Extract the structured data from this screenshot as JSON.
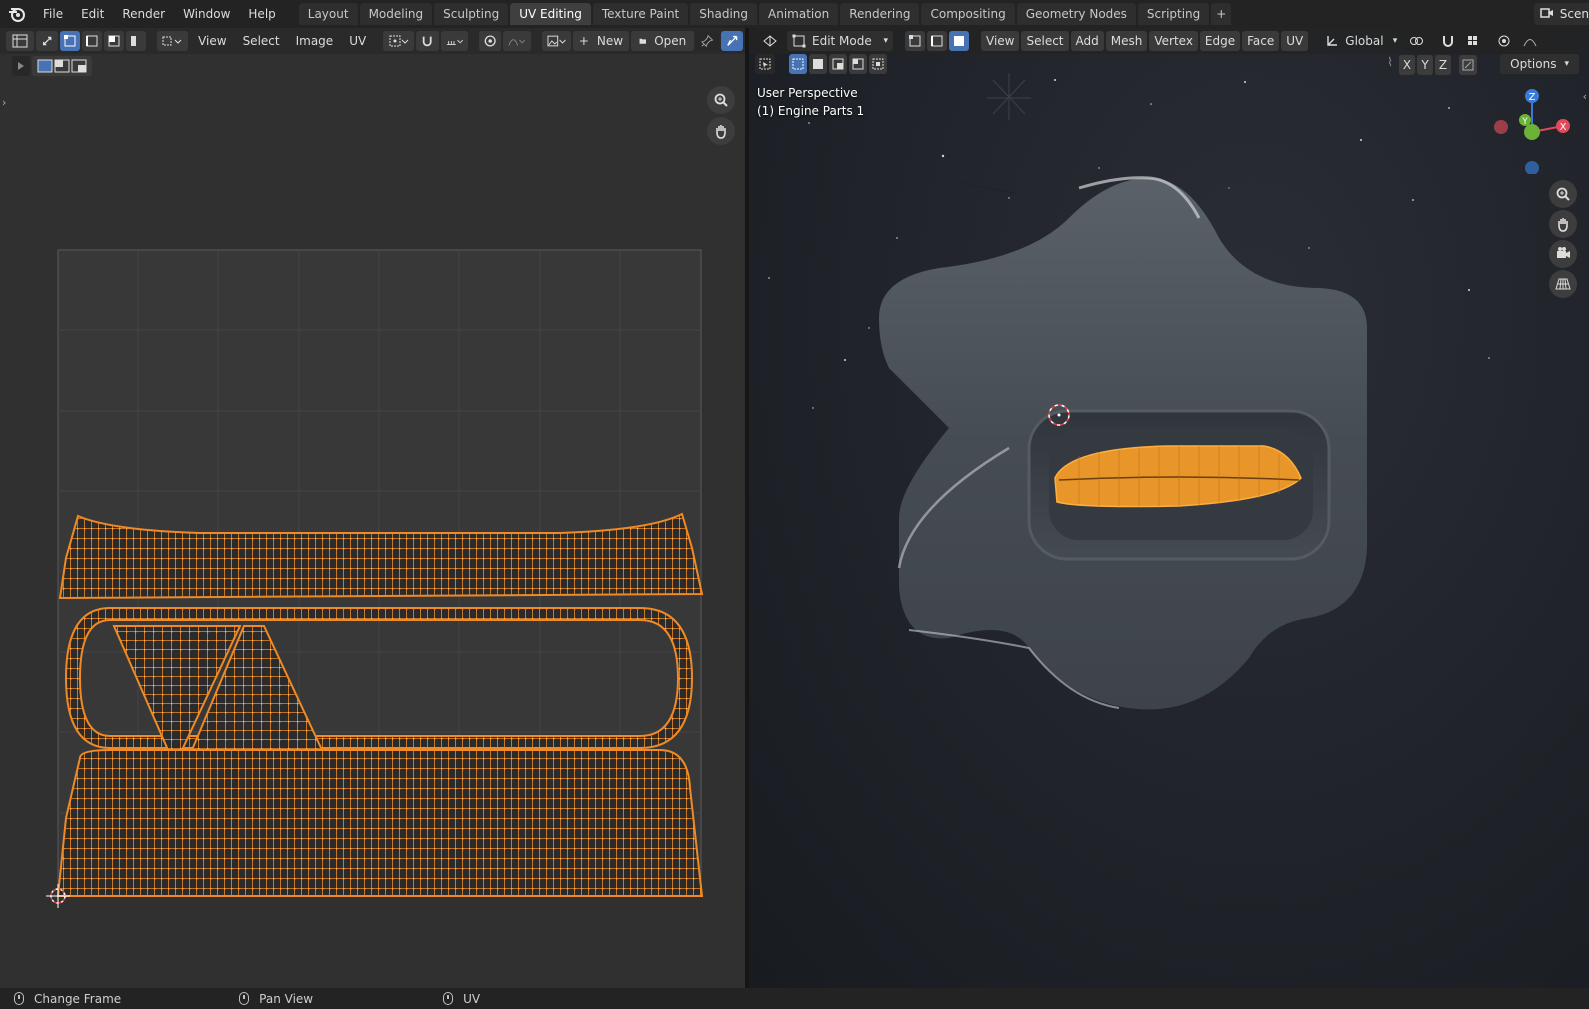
{
  "topbar": {
    "menus": [
      "File",
      "Edit",
      "Render",
      "Window",
      "Help"
    ],
    "tabs": [
      "Layout",
      "Modeling",
      "Sculpting",
      "UV Editing",
      "Texture Paint",
      "Shading",
      "Animation",
      "Rendering",
      "Compositing",
      "Geometry Nodes",
      "Scripting"
    ],
    "active_tab": "UV Editing",
    "add_tab": "+",
    "scene_label": "Scen"
  },
  "uv_editor": {
    "menus": [
      "View",
      "Select",
      "Image",
      "UV"
    ],
    "new_label": "New",
    "open_label": "Open",
    "new_prefix": "+"
  },
  "viewport": {
    "mode_label": "Edit Mode",
    "menus": [
      "View",
      "Select",
      "Add",
      "Mesh",
      "Vertex",
      "Edge",
      "Face",
      "UV"
    ],
    "transform_label": "Global",
    "perspective_label": "User Perspective",
    "object_label": "(1) Engine Parts 1",
    "options_label": "Options",
    "axis_buttons": [
      "X",
      "Y",
      "Z"
    ],
    "gizmo": {
      "z": "Z",
      "y": "Y",
      "x": "X"
    }
  },
  "statusbar": {
    "items": [
      "Change Frame",
      "Pan View",
      "UV"
    ]
  },
  "colors": {
    "accent": "#4772b3",
    "uv_orange": "#f08a24",
    "selection_orange": "#ff9a2e"
  }
}
